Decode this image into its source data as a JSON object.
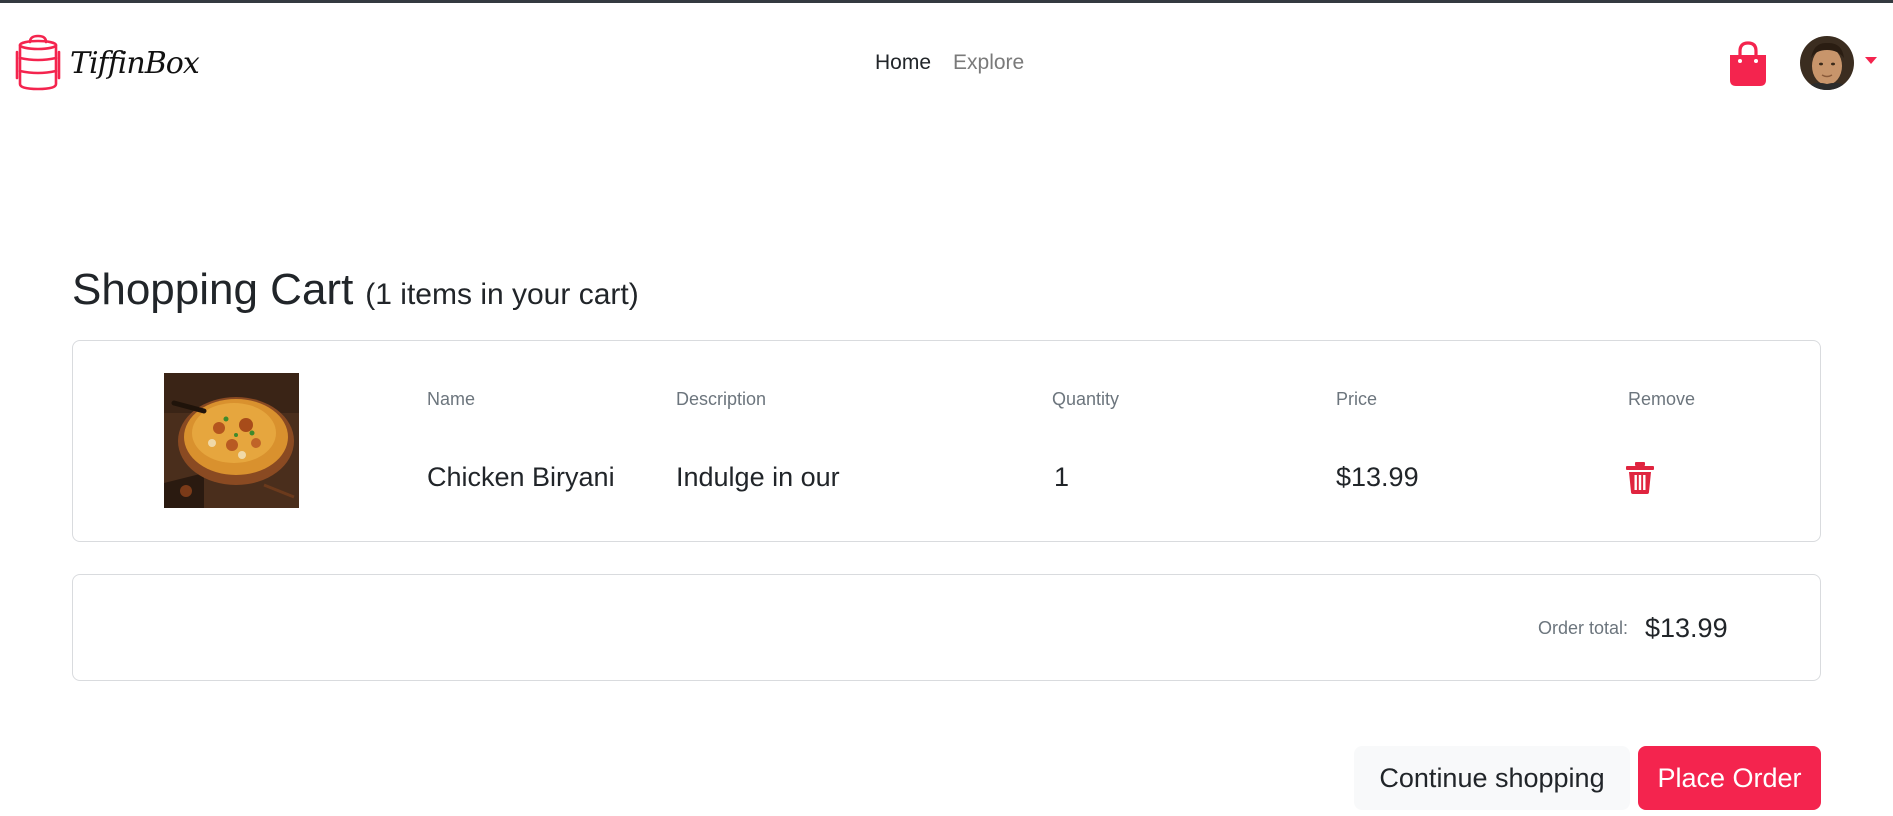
{
  "brand": {
    "name": "TiffinBox",
    "icon": "tiffin-box-icon",
    "accent_color": "#f4244e"
  },
  "nav": {
    "home_label": "Home",
    "explore_label": "Explore"
  },
  "header_icons": {
    "cart_icon": "shopping-bag-icon",
    "avatar": "user-avatar",
    "dropdown_icon": "caret-down-icon"
  },
  "cart": {
    "title": "Shopping Cart",
    "subtitle": "(1 items in your cart)",
    "columns": {
      "name": "Name",
      "description": "Description",
      "quantity": "Quantity",
      "price": "Price",
      "remove": "Remove"
    },
    "items": [
      {
        "image": "chicken-biryani-photo",
        "name": "Chicken Biryani",
        "description": "Indulge in our",
        "quantity": "1",
        "price": "$13.99",
        "remove_icon": "trash-icon"
      }
    ]
  },
  "summary": {
    "total_label": "Order total:",
    "total_value": "$13.99"
  },
  "actions": {
    "continue_label": "Continue shopping",
    "order_label": "Place Order"
  }
}
